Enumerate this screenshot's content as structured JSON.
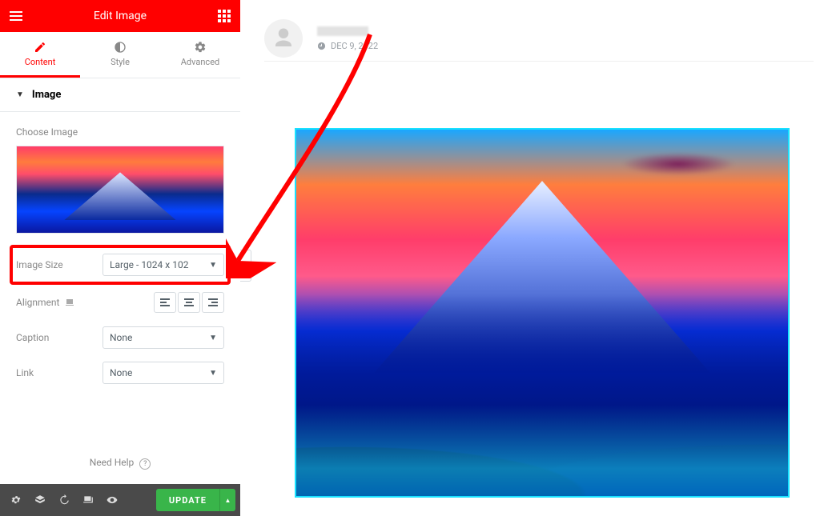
{
  "topbar": {
    "title": "Edit Image"
  },
  "tabs": {
    "content": "Content",
    "style": "Style",
    "advanced": "Advanced"
  },
  "section": {
    "title": "Image"
  },
  "controls": {
    "choose_label": "Choose Image",
    "image_size_label": "Image Size",
    "image_size_value": "Large - 1024 x 102",
    "alignment_label": "Alignment",
    "caption_label": "Caption",
    "caption_value": "None",
    "link_label": "Link",
    "link_value": "None"
  },
  "footer": {
    "update": "UPDATE"
  },
  "help": {
    "text": "Need Help"
  },
  "post": {
    "date": "DEC 9, 2022"
  }
}
